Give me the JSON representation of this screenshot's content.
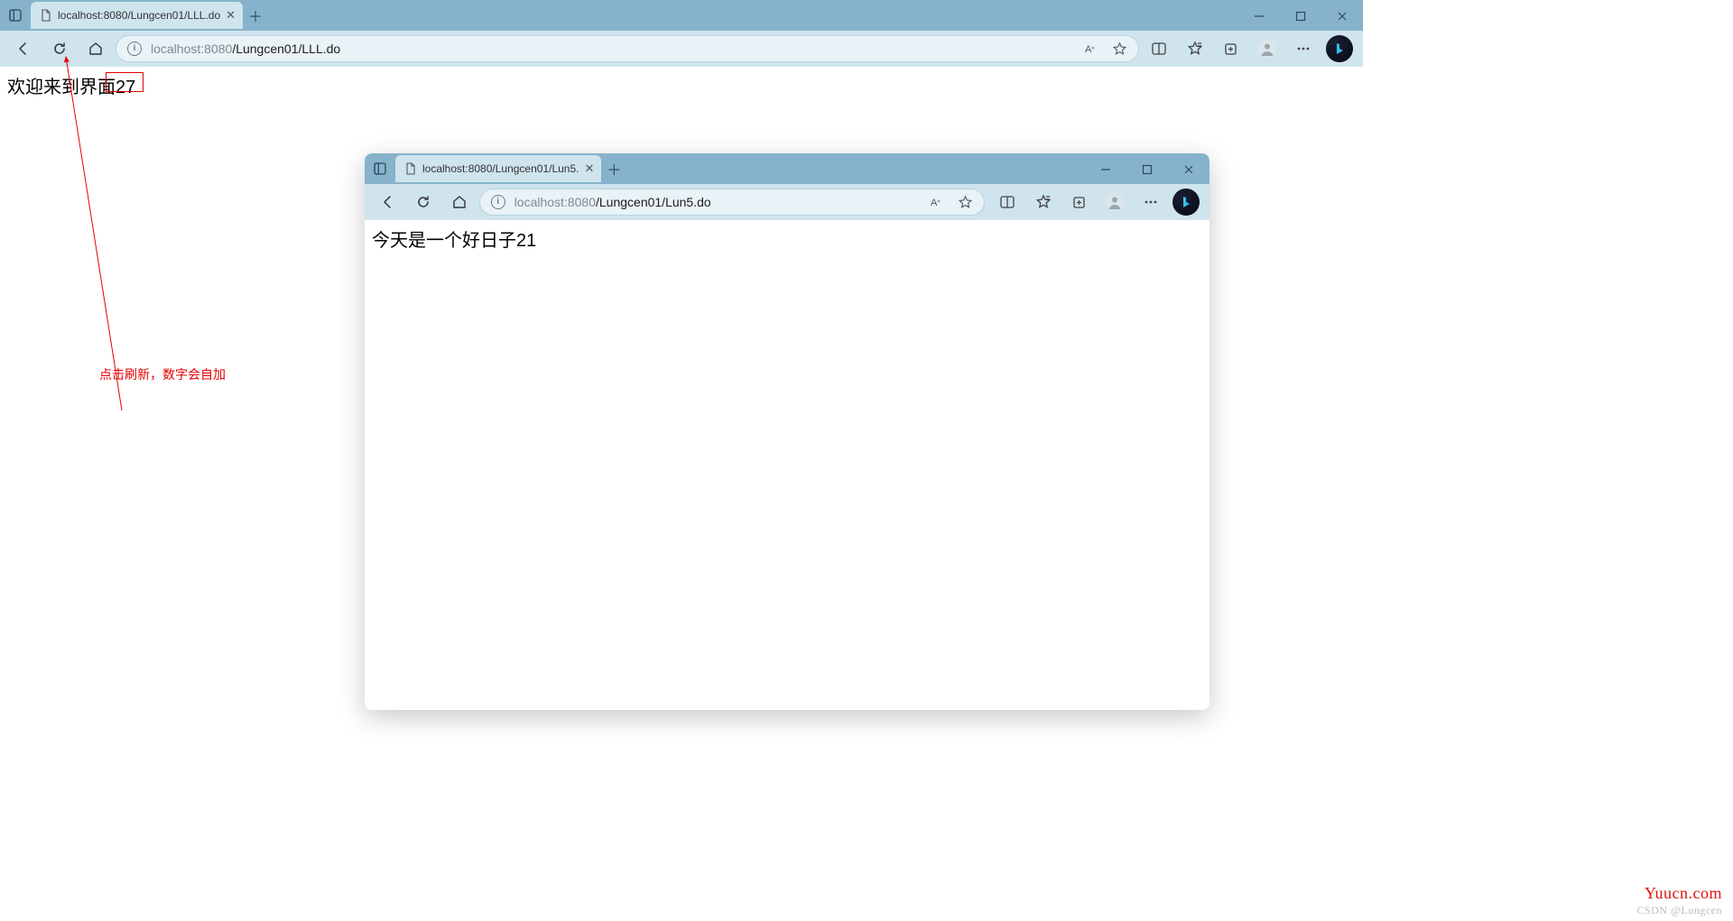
{
  "main": {
    "tab_title": "localhost:8080/Lungcen01/LLL.do",
    "url_host": "localhost",
    "url_port": ":8080",
    "url_path": "/Lungcen01/LLL.do",
    "page_text": "欢迎来到界面27"
  },
  "secondary": {
    "tab_title": "localhost:8080/Lungcen01/Lun5.",
    "url_host": "localhost",
    "url_port": ":8080",
    "url_path": "/Lungcen01/Lun5.do",
    "page_text": "今天是一个好日子21"
  },
  "annotation": "点击刷新，数字会自加",
  "watermark1": "Yuucn.com",
  "watermark2": "CSDN @Lungcen"
}
